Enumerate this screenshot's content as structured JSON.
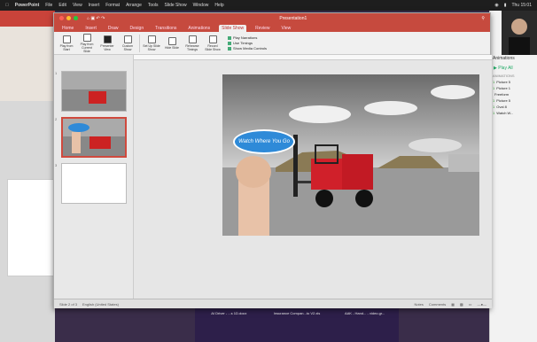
{
  "menubar": {
    "app": "PowerPoint",
    "items": [
      "File",
      "Edit",
      "View",
      "Insert",
      "Format",
      "Arrange",
      "Tools",
      "Slide Show",
      "Window",
      "Help"
    ],
    "clock": "Thu 15:01"
  },
  "window": {
    "title": "Presentation1",
    "tabs": [
      "Home",
      "Insert",
      "Draw",
      "Design",
      "Transitions",
      "Animations",
      "Slide Show",
      "Review",
      "View"
    ],
    "active_tab": "Slide Show"
  },
  "ribbon": {
    "buttons": [
      "Play from Start",
      "Play from Current Slide",
      "Presenter View",
      "Custom Show",
      "Set Up Slide Show",
      "Hide Slide",
      "Rehearse Timings",
      "Record Slide Show"
    ],
    "checks": [
      "Play Narrations",
      "Use Timings",
      "Show Media Controls"
    ]
  },
  "slide": {
    "bubble_text": "Watch Where You Go"
  },
  "statusbar": {
    "slide_info": "Slide 2 of 3",
    "language": "English (United States)",
    "notes": "Notes",
    "comments": "Comments"
  },
  "animation_pane": {
    "title": "Animations",
    "play_all": "Play All",
    "section": "ANIMATIONS",
    "items": [
      {
        "num": "1",
        "name": "Picture 5"
      },
      {
        "num": "1",
        "name": "Picture 1"
      },
      {
        "num": "",
        "name": "Freeform"
      },
      {
        "num": "1",
        "name": "Picture 5"
      },
      {
        "num": "1",
        "name": "Oval 8"
      },
      {
        "num": "1",
        "name": "Watch W..."
      }
    ]
  },
  "desktop": {
    "files": [
      "AI Driver - ...s 1D.docx",
      "Insurance Compan...to V2.xls",
      "AAK - Hand... - video.gr..."
    ]
  },
  "colors": {
    "accent": "#c64a3e",
    "forklift": "#d0202a",
    "bubble": "#2e8ad8"
  }
}
